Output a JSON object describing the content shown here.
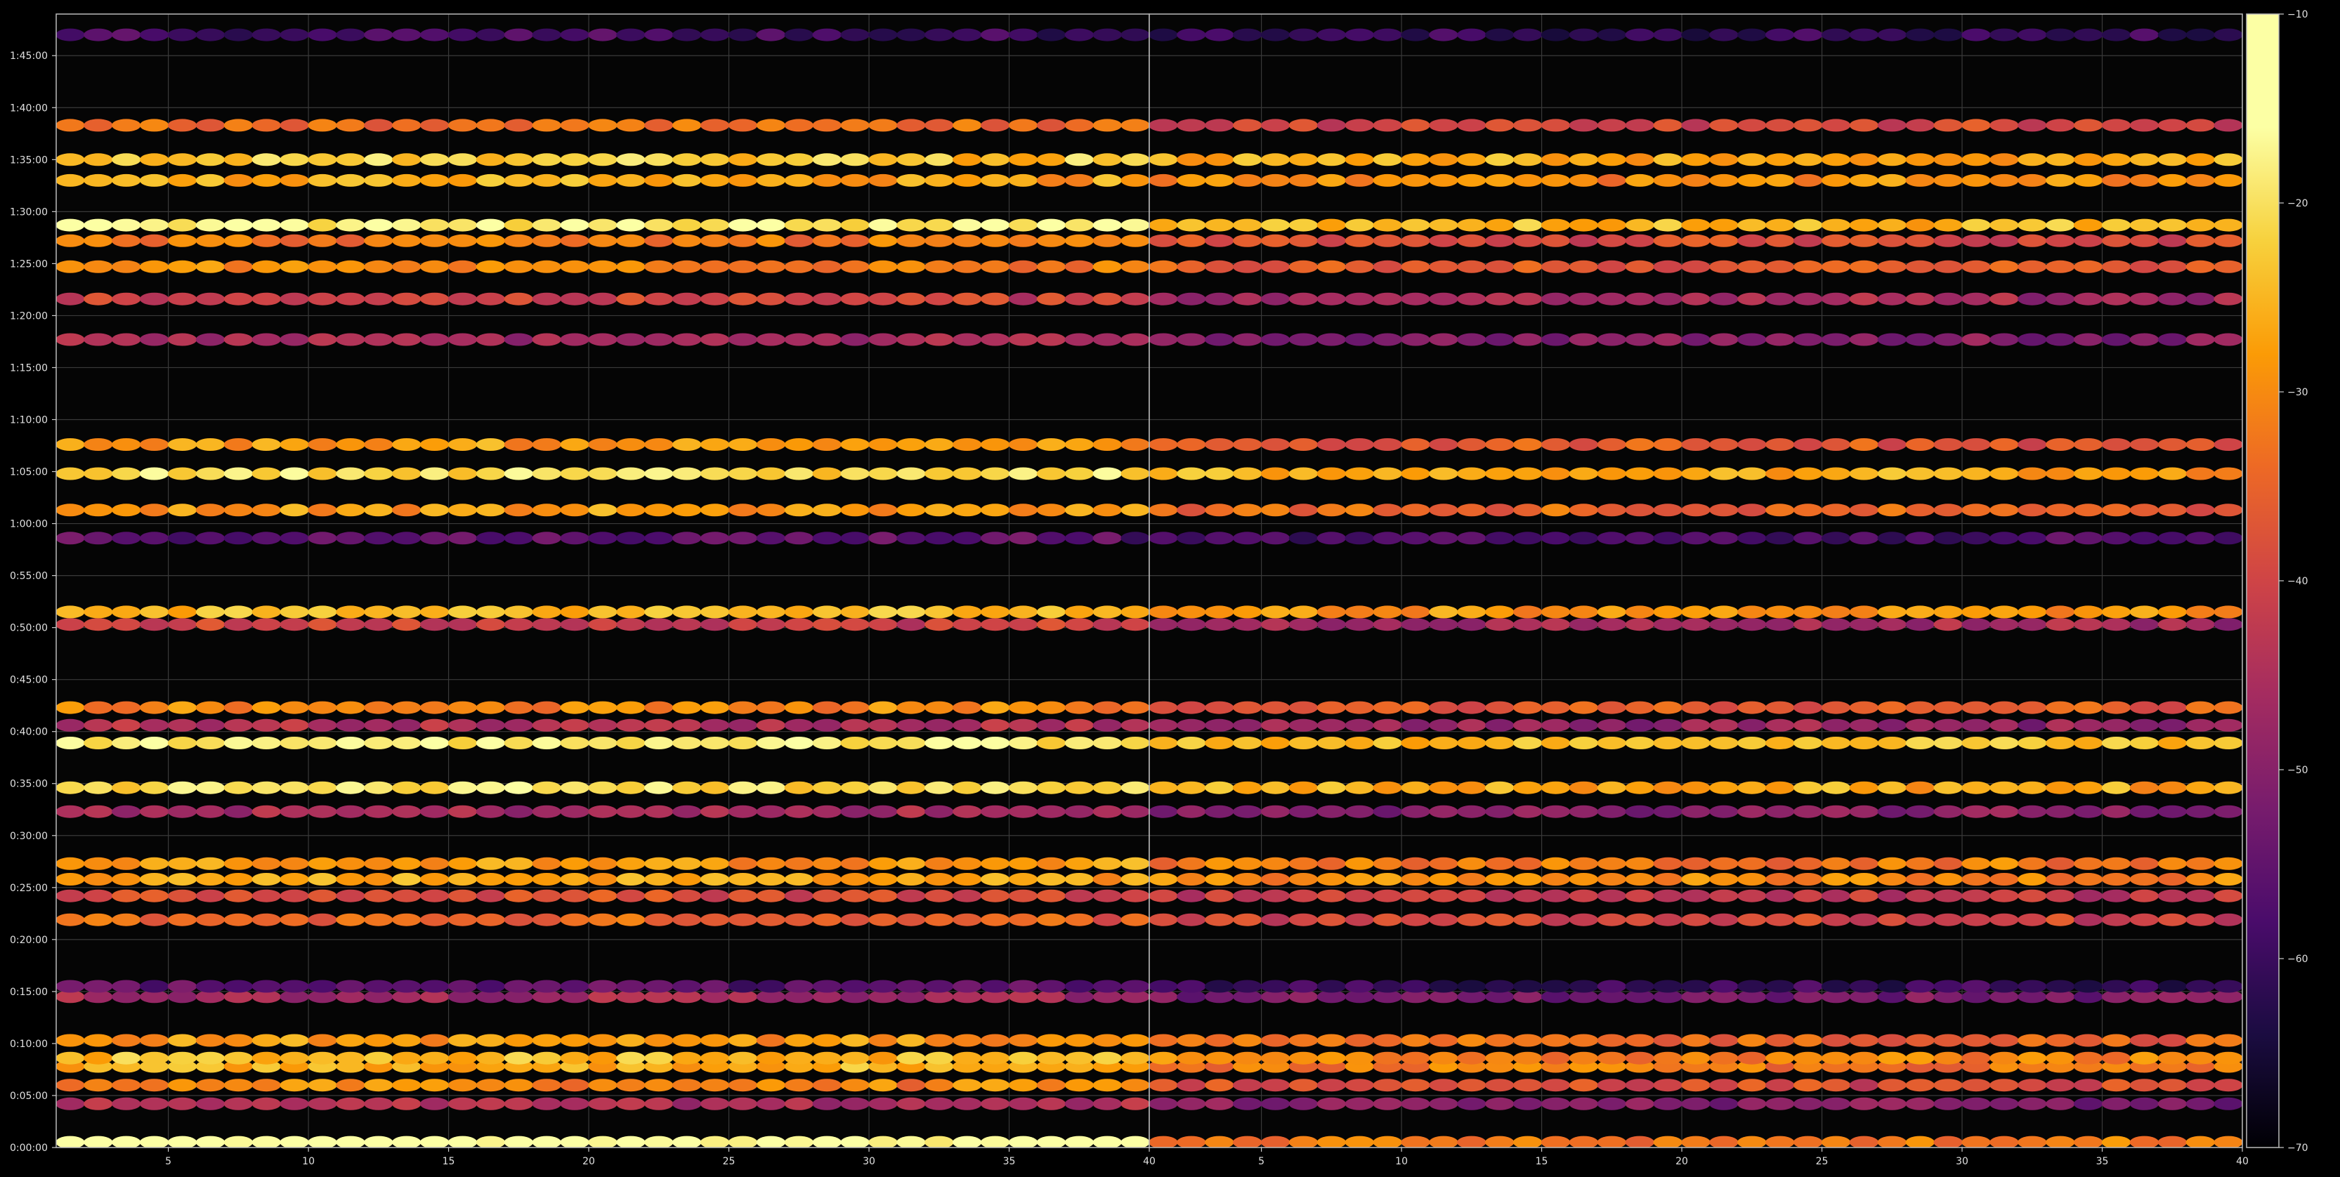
{
  "chart_data": {
    "type": "heatmap",
    "title": "",
    "xlabel": "",
    "ylabel": "",
    "panels": [
      {
        "name": "",
        "x_range": [
          1,
          40
        ]
      },
      {
        "name": "",
        "x_range": [
          1,
          40
        ]
      }
    ],
    "x_ticks": [
      5,
      10,
      15,
      20,
      25,
      30,
      35,
      40
    ],
    "x_tick_labels": [
      "5",
      "10",
      "15",
      "20",
      "25",
      "30",
      "35",
      "40"
    ],
    "y_range_minutes": [
      0,
      109
    ],
    "y_tick_minutes": [
      0,
      5,
      10,
      15,
      20,
      25,
      30,
      35,
      40,
      45,
      50,
      55,
      60,
      65,
      70,
      75,
      80,
      85,
      90,
      95,
      100,
      105
    ],
    "y_tick_labels": [
      "0:00:00",
      "0:05:00",
      "0:10:00",
      "0:15:00",
      "0:20:00",
      "0:25:00",
      "0:30:00",
      "0:35:00",
      "0:40:00",
      "0:45:00",
      "0:50:00",
      "0:55:00",
      "1:00:00",
      "1:05:00",
      "1:10:00",
      "1:15:00",
      "1:20:00",
      "1:25:00",
      "1:30:00",
      "1:35:00",
      "1:40:00",
      "1:45:00"
    ],
    "grid": true,
    "colormap": "inferno",
    "colorbar": {
      "range": [
        -70,
        -10
      ],
      "ticks": [
        -10,
        -20,
        -30,
        -40,
        -50,
        -60,
        -70
      ],
      "tick_labels": [
        "−10",
        "−20",
        "−30",
        "−40",
        "−50",
        "−60",
        "−70"
      ]
    },
    "columns_per_panel": 39,
    "bands": [
      {
        "minute": 0.5,
        "level": -14,
        "p2_level": -32
      },
      {
        "minute": 4.2,
        "level": -45,
        "p2_level": -50
      },
      {
        "minute": 6.0,
        "level": -30,
        "p2_level": -38
      },
      {
        "minute": 7.8,
        "level": -26,
        "p2_level": -32
      },
      {
        "minute": 8.6,
        "level": -24,
        "p2_level": -30
      },
      {
        "minute": 10.3,
        "level": -28,
        "p2_level": -34
      },
      {
        "minute": 14.5,
        "level": -46,
        "p2_level": -52
      },
      {
        "minute": 15.5,
        "level": -55,
        "p2_level": -60
      },
      {
        "minute": 21.9,
        "level": -34,
        "p2_level": -40
      },
      {
        "minute": 24.2,
        "level": -38,
        "p2_level": -42
      },
      {
        "minute": 25.8,
        "level": -26,
        "p2_level": -30
      },
      {
        "minute": 27.3,
        "level": -28,
        "p2_level": -32
      },
      {
        "minute": 32.3,
        "level": -46,
        "p2_level": -50
      },
      {
        "minute": 34.6,
        "level": -20,
        "p2_level": -26
      },
      {
        "minute": 38.9,
        "level": -18,
        "p2_level": -24
      },
      {
        "minute": 40.6,
        "level": -44,
        "p2_level": -48
      },
      {
        "minute": 42.3,
        "level": -30,
        "p2_level": -36
      },
      {
        "minute": 50.3,
        "level": -40,
        "p2_level": -46
      },
      {
        "minute": 51.5,
        "level": -24,
        "p2_level": -28
      },
      {
        "minute": 58.6,
        "level": -55,
        "p2_level": -58
      },
      {
        "minute": 61.3,
        "level": -28,
        "p2_level": -34
      },
      {
        "minute": 64.8,
        "level": -20,
        "p2_level": -26
      },
      {
        "minute": 67.6,
        "level": -28,
        "p2_level": -36
      },
      {
        "minute": 77.7,
        "level": -46,
        "p2_level": -50
      },
      {
        "minute": 81.6,
        "level": -40,
        "p2_level": -46
      },
      {
        "minute": 84.7,
        "level": -30,
        "p2_level": -36
      },
      {
        "minute": 87.2,
        "level": -32,
        "p2_level": -38
      },
      {
        "minute": 88.7,
        "level": -18,
        "p2_level": -24
      },
      {
        "minute": 93.0,
        "level": -26,
        "p2_level": -30
      },
      {
        "minute": 95.0,
        "level": -22,
        "p2_level": -26
      },
      {
        "minute": 98.3,
        "level": -34,
        "p2_level": -40
      },
      {
        "minute": 107.0,
        "level": -58,
        "p2_level": -60
      }
    ]
  }
}
